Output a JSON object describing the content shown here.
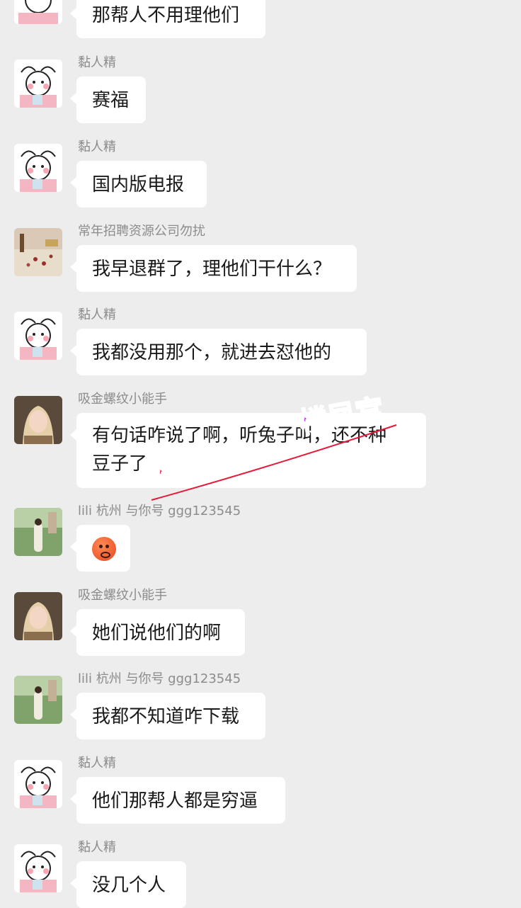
{
  "messages": [
    {
      "sender": "",
      "avatar": "cartoon",
      "text": "那帮人不用理他们"
    },
    {
      "sender": "黏人精",
      "avatar": "cartoon",
      "text": "赛福"
    },
    {
      "sender": "黏人精",
      "avatar": "cartoon",
      "text": "国内版电报"
    },
    {
      "sender": "常年招聘资源公司勿扰",
      "avatar": "photo-table",
      "text": "我早退群了，理他们干什么？"
    },
    {
      "sender": "黏人精",
      "avatar": "cartoon",
      "text": "我都没用那个，就进去怼他的"
    },
    {
      "sender": "吸金螺纹小能手",
      "avatar": "photo-woman",
      "text_line1": "有句话咋说了啊，听兔子叫，还不种",
      "text_line2": "豆子了"
    },
    {
      "sender": "lili 杭州 与你号 ggg123545",
      "avatar": "photo-garden",
      "emoji": "cold-sweat-emoji"
    },
    {
      "sender": "吸金螺纹小能手",
      "avatar": "photo-woman",
      "text": "她们说他们的啊"
    },
    {
      "sender": "lili 杭州 与你号 ggg123545",
      "avatar": "photo-garden",
      "text": "我都不知道咋下载"
    },
    {
      "sender": "黏人精",
      "avatar": "cartoon",
      "text": "他们那帮人都是穷逼"
    },
    {
      "sender": "黏人精",
      "avatar": "cartoon",
      "text": "没几个人"
    }
  ],
  "watermark": {
    "text1": "楼凤宫",
    "text2": "楼凤宫",
    "color1": "#e61a39",
    "color2": "#b322e6"
  },
  "colors": {
    "background": "#ededed",
    "bubble": "#ffffff",
    "sender": "#8c8c8c"
  }
}
